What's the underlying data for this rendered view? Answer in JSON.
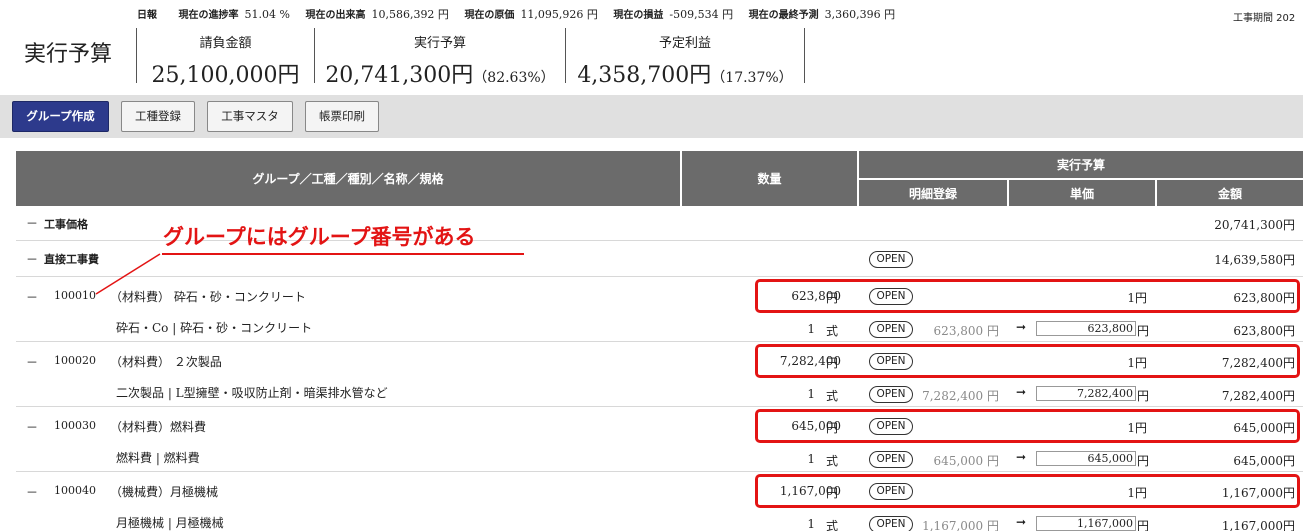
{
  "summary": {
    "items": [
      {
        "label": "日報",
        "value": ""
      },
      {
        "label": "現在の進捗率",
        "value": "51.04 %"
      },
      {
        "label": "現在の出来高",
        "value": "10,586,392 円"
      },
      {
        "label": "現在の原価",
        "value": "11,095,926 円"
      },
      {
        "label": "現在の損益",
        "value": "-509,534 円"
      },
      {
        "label": "現在の最終予測",
        "value": "3,360,396 円"
      }
    ],
    "period_label": "工事期間 202"
  },
  "page_title": "実行予算",
  "metrics": [
    {
      "label": "請負金額",
      "value": "25,100,000円",
      "pct": ""
    },
    {
      "label": "実行予算",
      "value": "20,741,300円",
      "pct": "（82.63%）"
    },
    {
      "label": "予定利益",
      "value": "4,358,700円",
      "pct": "（17.37%）"
    }
  ],
  "toolbar": {
    "group_create": "グループ作成",
    "trade_register": "工種登録",
    "trade_master": "工事マスタ",
    "print": "帳票印刷"
  },
  "table": {
    "headers": {
      "name": "グループ／工種／種別／名称／規格",
      "quantity": "数量",
      "budget": "実行予算",
      "detail": "明細登録",
      "unit_price": "単価",
      "amount": "金額"
    },
    "open_label": "OPEN",
    "arrow": "➞",
    "rows": [
      {
        "dash": "－",
        "name": "工事価格",
        "amount": "20,741,300円"
      },
      {
        "dash": "－",
        "name": "直接工事費",
        "amount": "14,639,580円"
      },
      {
        "dash": "－",
        "code": "100010",
        "name": "（材料費） 砕石・砂・コンクリート",
        "qty": "623,800",
        "unit": "円",
        "price": "1円",
        "amount": "623,800円",
        "sub": {
          "name": "砕石・Co | 砕石・砂・コンクリート",
          "qty": "1",
          "unit": "式",
          "orig": "623,800 円",
          "input": "623,800",
          "yen": "円",
          "amount": "623,800円"
        }
      },
      {
        "dash": "－",
        "code": "100020",
        "name": "（材料費） ２次製品",
        "qty": "7,282,400",
        "unit": "円",
        "price": "1円",
        "amount": "7,282,400円",
        "sub": {
          "name": "二次製品 | L型擁壁・吸収防止剤・暗渠排水管など",
          "qty": "1",
          "unit": "式",
          "orig": "7,282,400 円",
          "input": "7,282,400",
          "yen": "円",
          "amount": "7,282,400円"
        }
      },
      {
        "dash": "－",
        "code": "100030",
        "name": "（材料費）燃料費",
        "qty": "645,000",
        "unit": "円",
        "price": "1円",
        "amount": "645,000円",
        "sub": {
          "name": "燃料費 | 燃料費",
          "qty": "1",
          "unit": "式",
          "orig": "645,000 円",
          "input": "645,000",
          "yen": "円",
          "amount": "645,000円"
        }
      },
      {
        "dash": "－",
        "code": "100040",
        "name": "（機械費）月極機械",
        "qty": "1,167,000",
        "unit": "円",
        "price": "1円",
        "amount": "1,167,000円",
        "sub": {
          "name": "月極機械 | 月極機械",
          "qty": "1",
          "unit": "式",
          "orig": "1,167,000 円",
          "input": "1,167,000",
          "yen": "円",
          "amount": "1,167,000円"
        }
      }
    ]
  },
  "annotation": "グループにはグループ番号がある"
}
